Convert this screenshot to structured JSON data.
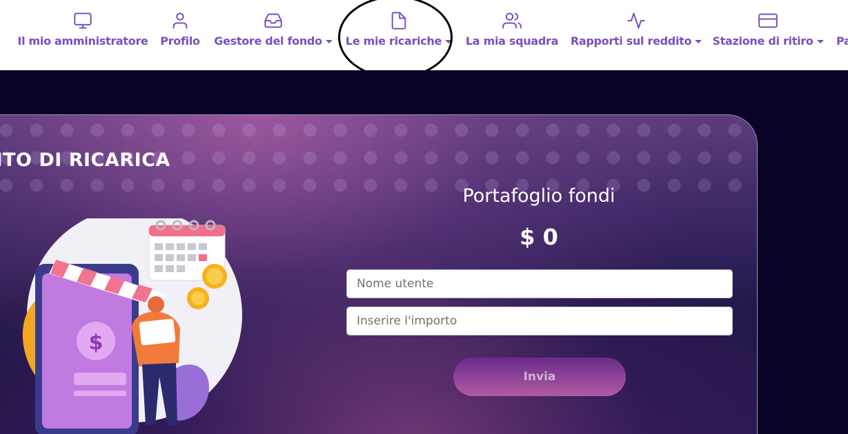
{
  "nav": {
    "items": [
      {
        "label": "Il mio amministratore",
        "icon": "monitor-icon",
        "dropdown": false
      },
      {
        "label": "Profilo",
        "icon": "user-icon",
        "dropdown": false
      },
      {
        "label": "Gestore del fondo",
        "icon": "inbox-icon",
        "dropdown": true
      },
      {
        "label": "Le mie ricariche",
        "icon": "file-icon",
        "dropdown": true
      },
      {
        "label": "La mia squadra",
        "icon": "users-icon",
        "dropdown": false
      },
      {
        "label": "Rapporti sul reddito",
        "icon": "activity-icon",
        "dropdown": true
      },
      {
        "label": "Stazione di ritiro",
        "icon": "credit-card-icon",
        "dropdown": true
      },
      {
        "label": "Pa",
        "icon": "",
        "dropdown": false
      }
    ]
  },
  "card": {
    "title": "NTO DI RICARICA",
    "wallet_title": "Portafoglio fondi",
    "wallet_amount": "$ 0",
    "username_placeholder": "Nome utente",
    "amount_placeholder": "Inserire l'importo",
    "submit_label": "Invia"
  },
  "colors": {
    "nav_text": "#7a4fc0",
    "page_background": "#0a0325",
    "button_gradient_start": "#6a2b8a",
    "button_gradient_end": "#b05aa4"
  }
}
